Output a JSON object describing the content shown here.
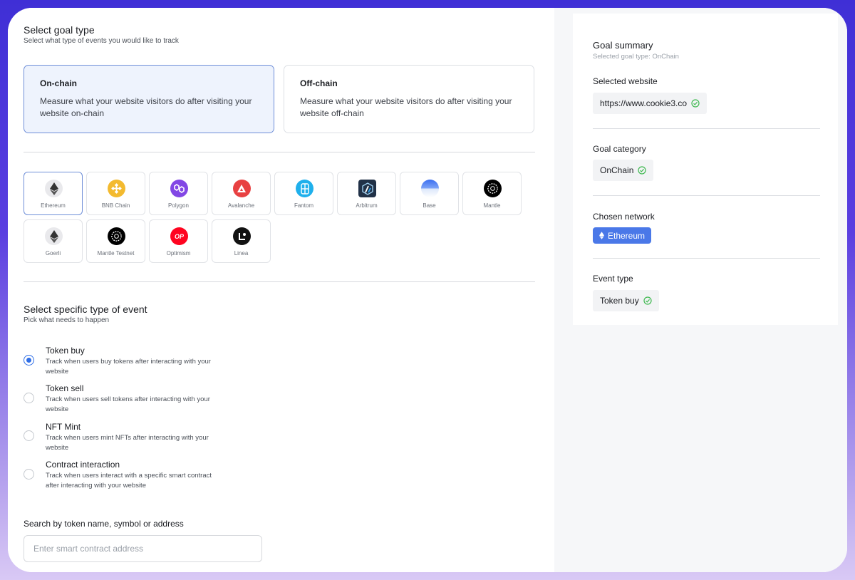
{
  "goal_type": {
    "title": "Select goal type",
    "subtitle": "Select what type of events you would like to track",
    "options": [
      {
        "title": "On-chain",
        "desc": "Measure what your website visitors do after visiting your website on-chain",
        "selected": true
      },
      {
        "title": "Off-chain",
        "desc": "Measure what your website visitors do after visiting your website off-chain",
        "selected": false
      }
    ]
  },
  "networks": [
    {
      "label": "Ethereum",
      "icon": "ethereum-icon",
      "color": "#e9e9ec",
      "selected": true
    },
    {
      "label": "BNB Chain",
      "icon": "bnb-icon",
      "color": "#f3ba2f",
      "selected": false
    },
    {
      "label": "Polygon",
      "icon": "polygon-icon",
      "color": "#8247e5",
      "selected": false
    },
    {
      "label": "Avalanche",
      "icon": "avalanche-icon",
      "color": "#e84142",
      "selected": false
    },
    {
      "label": "Fantom",
      "icon": "fantom-icon",
      "color": "#1fb0ec",
      "selected": false
    },
    {
      "label": "Arbitrum",
      "icon": "arbitrum-icon",
      "color": "#213147",
      "selected": false
    },
    {
      "label": "Base",
      "icon": "base-icon",
      "color": "#3a6ef0",
      "selected": false
    },
    {
      "label": "Mantle",
      "icon": "mantle-icon",
      "color": "#000000",
      "selected": false
    },
    {
      "label": "Goerli",
      "icon": "ethereum-icon",
      "color": "#e9e9ec",
      "selected": false
    },
    {
      "label": "Mantle Testnet",
      "icon": "mantle-icon",
      "color": "#000000",
      "selected": false
    },
    {
      "label": "Optimism",
      "icon": "optimism-icon",
      "color": "#ff0420",
      "selected": false
    },
    {
      "label": "Linea",
      "icon": "linea-icon",
      "color": "#121212",
      "selected": false
    }
  ],
  "event_type": {
    "title": "Select specific type of event",
    "subtitle": "Pick what needs to happen",
    "options": [
      {
        "title": "Token buy",
        "desc_line1": "Track when users buy tokens after interacting with your",
        "desc_line2": "website",
        "checked": true
      },
      {
        "title": "Token sell",
        "desc_line1": "Track when users sell tokens after interacting with your",
        "desc_line2": "website",
        "checked": false
      },
      {
        "title": "NFT Mint",
        "desc_line1": "Track when users mint NFTs after interacting with your",
        "desc_line2": "website",
        "checked": false
      },
      {
        "title": "Contract interaction",
        "desc_line1": "Track when users interact with a specific smart contract",
        "desc_line2": "after interacting with your website",
        "checked": false
      }
    ]
  },
  "search": {
    "label": "Search by token name, symbol or address",
    "placeholder": "Enter smart contract address",
    "value": ""
  },
  "summary": {
    "title": "Goal summary",
    "subtitle": "Selected goal type: OnChain",
    "website_label": "Selected website",
    "website_value": "https://www.cookie3.co",
    "category_label": "Goal category",
    "category_value": "OnChain",
    "network_label": "Chosen network",
    "network_value": "Ethereum",
    "event_label": "Event type",
    "event_value": "Token buy"
  },
  "colors": {
    "accent": "#2f6ee6",
    "network_chip": "#4a78e8",
    "check_green": "#3fb950",
    "selected_border": "#6f8fd8"
  }
}
